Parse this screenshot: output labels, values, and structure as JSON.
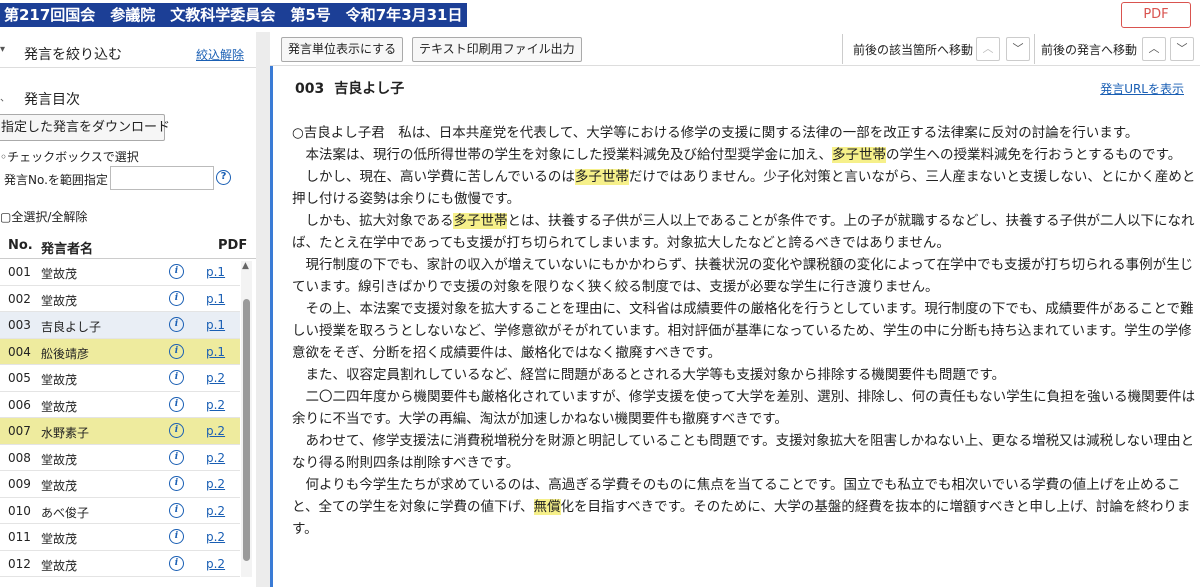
{
  "header": {
    "title": "第217回国会　参議院　文教科学委員会　第5号　令和7年3月31日",
    "pdf_label": "PDF"
  },
  "sidebar": {
    "filter_label": "発言を絞り込む",
    "filter_clear": "絞込解除",
    "toc_label": "発言目次",
    "download_button": "指定した発言をダウンロード",
    "checkbox_option": "チェックボックスで選択",
    "range_label": "発言No.を範囲指定",
    "range_value": "",
    "select_all": "全選択/全解除",
    "columns": {
      "no": "No.",
      "speaker": "発言者名",
      "pdf": "PDF"
    },
    "rows": [
      {
        "no": "001",
        "name": "堂故茂",
        "page": "p.1"
      },
      {
        "no": "002",
        "name": "堂故茂",
        "page": "p.1"
      },
      {
        "no": "003",
        "name": "吉良よし子",
        "page": "p.1"
      },
      {
        "no": "004",
        "name": "舩後靖彦",
        "page": "p.1"
      },
      {
        "no": "005",
        "name": "堂故茂",
        "page": "p.2"
      },
      {
        "no": "006",
        "name": "堂故茂",
        "page": "p.2"
      },
      {
        "no": "007",
        "name": "水野素子",
        "page": "p.2"
      },
      {
        "no": "008",
        "name": "堂故茂",
        "page": "p.2"
      },
      {
        "no": "009",
        "name": "堂故茂",
        "page": "p.2"
      },
      {
        "no": "010",
        "name": "あべ俊子",
        "page": "p.2"
      },
      {
        "no": "011",
        "name": "堂故茂",
        "page": "p.2"
      },
      {
        "no": "012",
        "name": "堂故茂",
        "page": "p.2"
      }
    ]
  },
  "toolbar": {
    "unit_display": "発言単位表示にする",
    "text_print": "テキスト印刷用ファイル出力",
    "nav_match": "前後の該当箇所へ移動",
    "nav_speech": "前後の発言へ移動"
  },
  "speech": {
    "number": "003",
    "speaker": "吉良よし子",
    "url_link": "発言URLを表示",
    "paragraphs": [
      [
        "○吉良よし子君　私は、日本共産党を代表して、大学等における修学の支援に関する法律の一部を改正する法律案に反対の討論を行います。"
      ],
      [
        "　本法案は、現行の低所得世帯の学生を対象にした授業料減免及び給付型奨学金に加え、",
        {
          "hl": "多子世帯"
        },
        "の学生への授業料減免を行おうとするものです。"
      ],
      [
        "　しかし、現在、高い学費に苦しんでいるのは",
        {
          "hl": "多子世帯"
        },
        "だけではありません。少子化対策と言いながら、三人産まないと支援しない、とにかく産めと押し付ける姿勢は余りにも傲慢です。"
      ],
      [
        "　しかも、拡大対象である",
        {
          "hl": "多子世帯"
        },
        "とは、扶養する子供が三人以上であることが条件です。上の子が就職するなどし、扶養する子供が二人以下になれば、たとえ在学中であっても支援が打ち切られてしまいます。対象拡大したなどと誇るべきではありません。"
      ],
      [
        "　現行制度の下でも、家計の収入が増えていないにもかかわらず、扶養状況の変化や課税額の変化によって在学中でも支援が打ち切られる事例が生じています。線引きばかりで支援の対象を限りなく狭く絞る制度では、支援が必要な学生に行き渡りません。"
      ],
      [
        "　その上、本法案で支援対象を拡大することを理由に、文科省は成績要件の厳格化を行うとしています。現行制度の下でも、成績要件があることで難しい授業を取ろうとしないなど、学修意欲がそがれています。相対評価が基準になっているため、学生の中に分断も持ち込まれています。学生の学修意欲をそぎ、分断を招く成績要件は、厳格化ではなく撤廃すべきです。"
      ],
      [
        "　また、収容定員割れしているなど、経営に問題があるとされる大学等も支援対象から排除する機関要件も問題です。"
      ],
      [
        "　二〇二四年度から機関要件も厳格化されていますが、修学支援を使って大学を差別、選別、排除し、何の責任もない学生に負担を強いる機関要件は余りに不当です。大学の再編、淘汰が加速しかねない機関要件も撤廃すべきです。"
      ],
      [
        "　あわせて、修学支援法に消費税増税分を財源と明記していることも問題です。支援対象拡大を阻害しかねない上、更なる増税又は減税しない理由となり得る附則四条は削除すべきです。"
      ],
      [
        "　何よりも今学生たちが求めているのは、高過ぎる学費そのものに焦点を当てることです。国立でも私立でも相次いでいる学費の値上げを止めること、全ての学生を対象に学費の値下げ、",
        {
          "hl": "無償"
        },
        "化を目指すべきです。そのために、大学の基盤的経費を抜本的に増額すべきと申し上げ、討論を終わります。"
      ]
    ]
  },
  "colors": {
    "title_bg": "#1c3f96",
    "highlight": "#f6f08a",
    "row_highlight": "#eeeb9e",
    "link": "#1a5fb4",
    "accent": "#3a7bd5",
    "pdf_red": "#d9534f"
  }
}
